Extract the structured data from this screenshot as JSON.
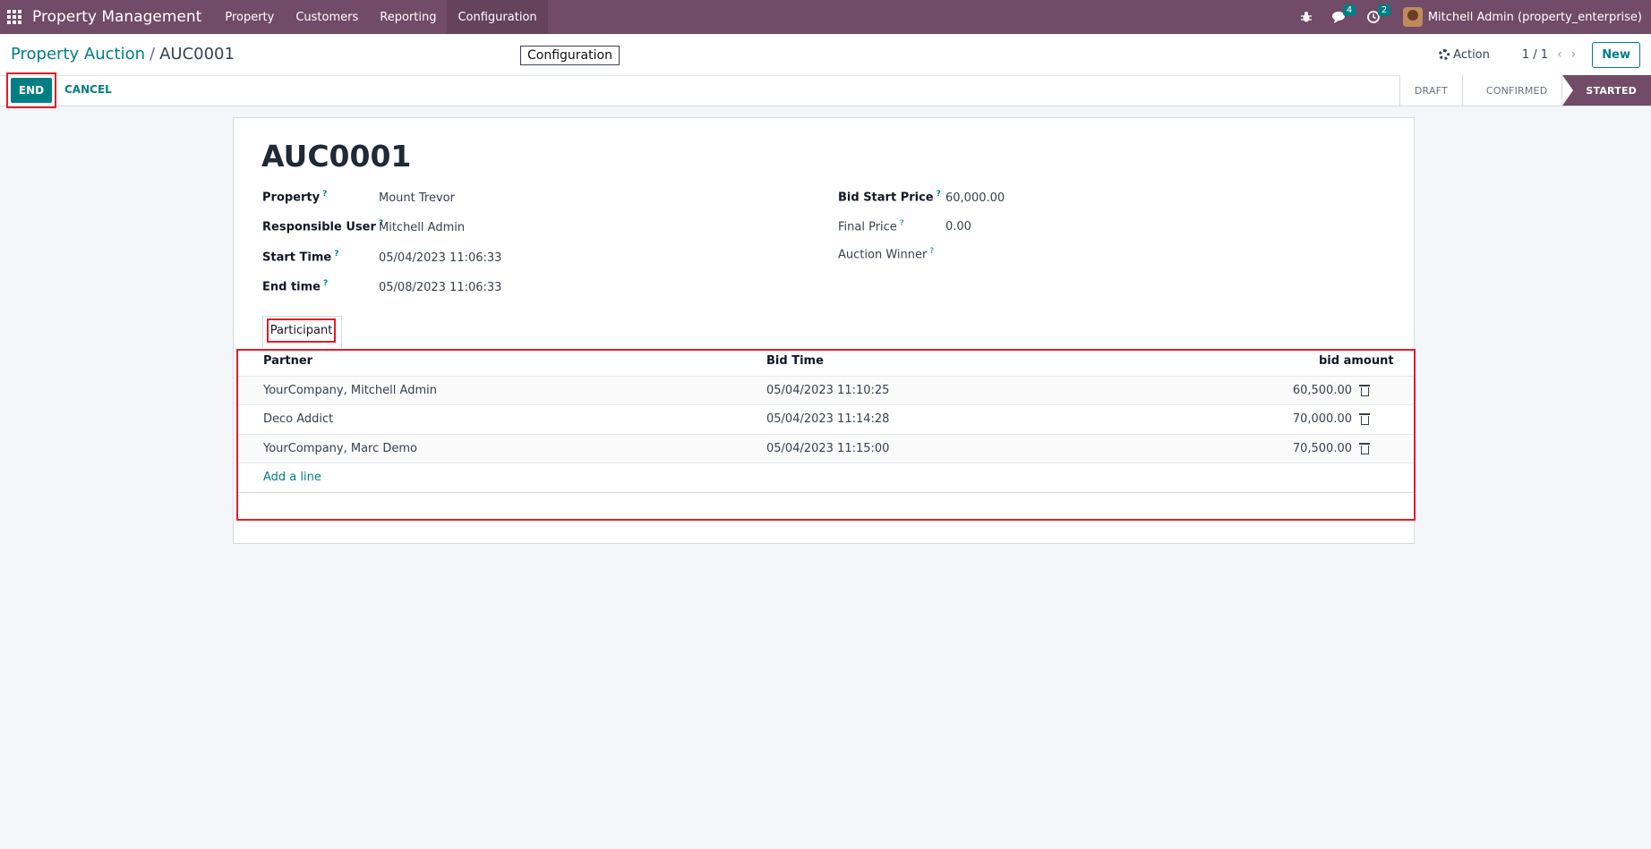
{
  "navbar": {
    "brand": "Property Management",
    "menu": [
      "Property",
      "Customers",
      "Reporting",
      "Configuration"
    ],
    "messages_count": "4",
    "activities_count": "2",
    "user": "Mitchell Admin (property_enterprise)"
  },
  "breadcrumb": {
    "parent": "Property Auction",
    "separator": "/",
    "current": "AUC0001"
  },
  "tooltip": "Configuration",
  "control": {
    "action": "Action",
    "pager": "1 / 1",
    "new": "New"
  },
  "buttons": {
    "end": "END",
    "cancel": "CANCEL"
  },
  "stages": [
    "DRAFT",
    "CONFIRMED",
    "STARTED"
  ],
  "record": {
    "name": "AUC0001",
    "left_fields": [
      {
        "label": "Property",
        "value": "Mount Trevor"
      },
      {
        "label": "Responsible User",
        "value": "Mitchell Admin"
      },
      {
        "label": "Start Time",
        "value": "05/04/2023 11:06:33"
      },
      {
        "label": "End time",
        "value": "05/08/2023 11:06:33"
      }
    ],
    "right_fields": [
      {
        "label": "Bid Start Price",
        "value": "60,000.00"
      },
      {
        "label": "Final Price",
        "value": "0.00"
      },
      {
        "label": "Auction Winner",
        "value": ""
      }
    ],
    "help_mark": "?"
  },
  "tab": {
    "label": "Participant"
  },
  "table": {
    "headers": [
      "Partner",
      "Bid Time",
      "bid amount"
    ],
    "rows": [
      {
        "partner": "YourCompany, Mitchell Admin",
        "bid_time": "05/04/2023 11:10:25",
        "amount": "60,500.00"
      },
      {
        "partner": "Deco Addict",
        "bid_time": "05/04/2023 11:14:28",
        "amount": "70,000.00"
      },
      {
        "partner": "YourCompany, Marc Demo",
        "bid_time": "05/04/2023 11:15:00",
        "amount": "70,500.00"
      }
    ],
    "add_line": "Add a line"
  }
}
